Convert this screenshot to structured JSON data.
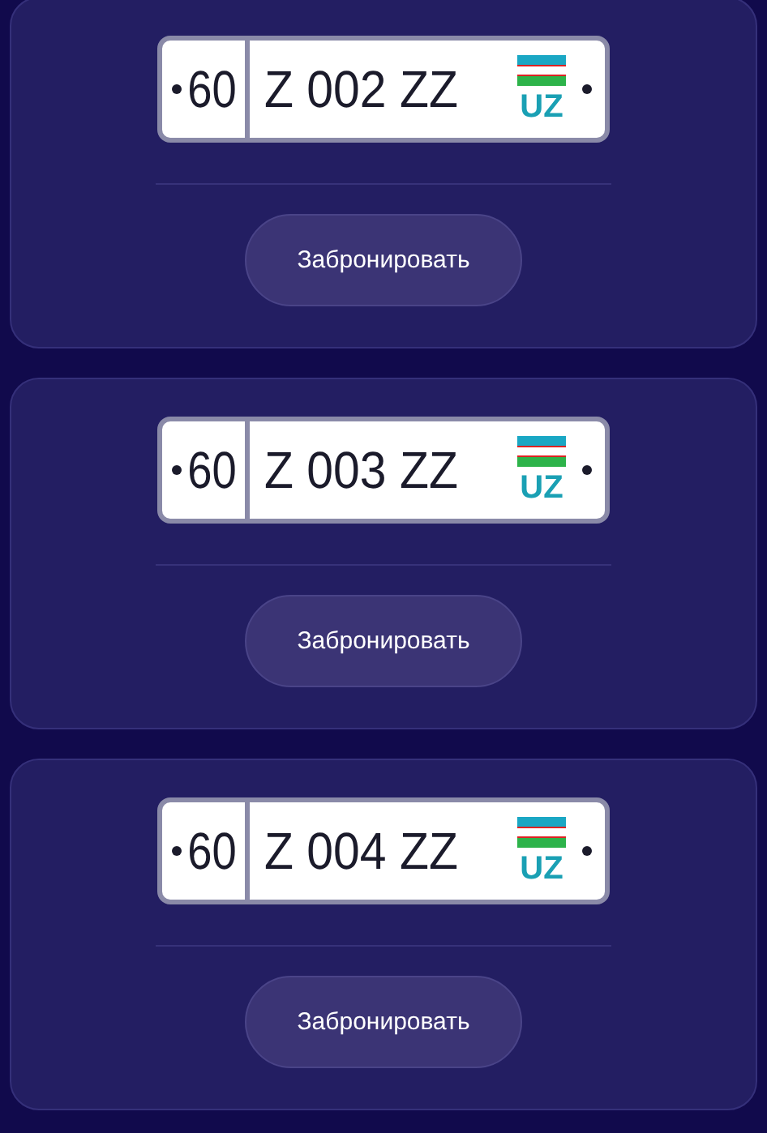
{
  "cards": [
    {
      "plate": {
        "region": "60",
        "number": "Z 002 ZZ",
        "country": "UZ"
      },
      "button": "Забронировать"
    },
    {
      "plate": {
        "region": "60",
        "number": "Z 003 ZZ",
        "country": "UZ"
      },
      "button": "Забронировать"
    },
    {
      "plate": {
        "region": "60",
        "number": "Z 004 ZZ",
        "country": "UZ"
      },
      "button": "Забронировать"
    }
  ]
}
